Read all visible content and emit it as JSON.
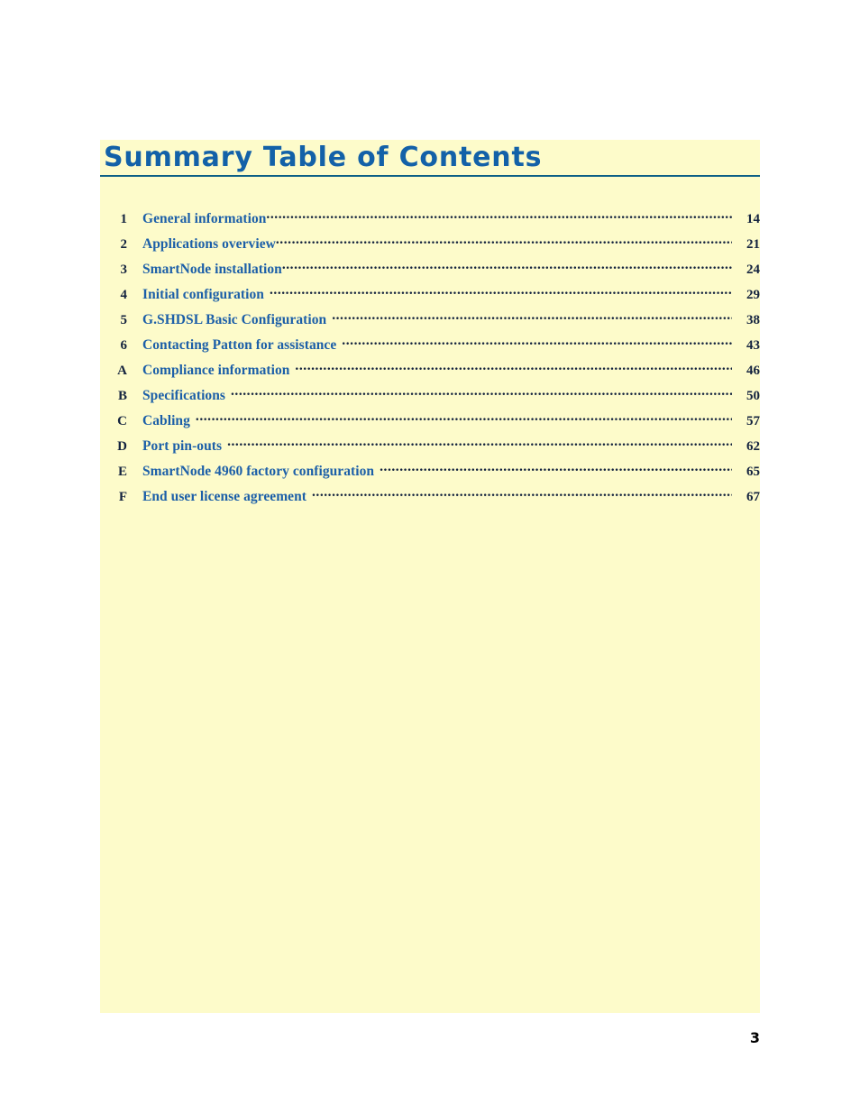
{
  "document": {
    "page_background": "#ffffff",
    "panel_background": "#fdfbca",
    "title_color": "#1361a8",
    "entry_color": "#1c5fa8",
    "number_color": "#14233f",
    "rule_color": "#0d5f86"
  },
  "header": {
    "title": "Summary Table of Contents"
  },
  "toc": {
    "leader": "dotted",
    "entries": [
      {
        "number": "1",
        "label": "General information",
        "page": "14",
        "space_before_leader": false
      },
      {
        "number": "2",
        "label": "Applications overview",
        "page": "21",
        "space_before_leader": false
      },
      {
        "number": "3",
        "label": "SmartNode installation",
        "page": "24",
        "space_before_leader": false
      },
      {
        "number": "4",
        "label": "Initial configuration",
        "page": "29",
        "space_before_leader": true
      },
      {
        "number": "5",
        "label": "G.SHDSL Basic Configuration",
        "page": "38",
        "space_before_leader": true
      },
      {
        "number": "6",
        "label": "Contacting Patton for assistance",
        "page": "43",
        "space_before_leader": true
      },
      {
        "number": "A",
        "label": "Compliance information",
        "page": "46",
        "space_before_leader": true
      },
      {
        "number": "B",
        "label": "Specifications",
        "page": "50",
        "space_before_leader": true
      },
      {
        "number": "C",
        "label": "Cabling",
        "page": "57",
        "space_before_leader": true
      },
      {
        "number": "D",
        "label": "Port pin-outs",
        "page": "62",
        "space_before_leader": true
      },
      {
        "number": "E",
        "label": "SmartNode 4960 factory configuration",
        "page": "65",
        "space_before_leader": true
      },
      {
        "number": "F",
        "label": "End user license agreement",
        "page": "67",
        "space_before_leader": true
      }
    ]
  },
  "footer": {
    "page_number": "3"
  }
}
